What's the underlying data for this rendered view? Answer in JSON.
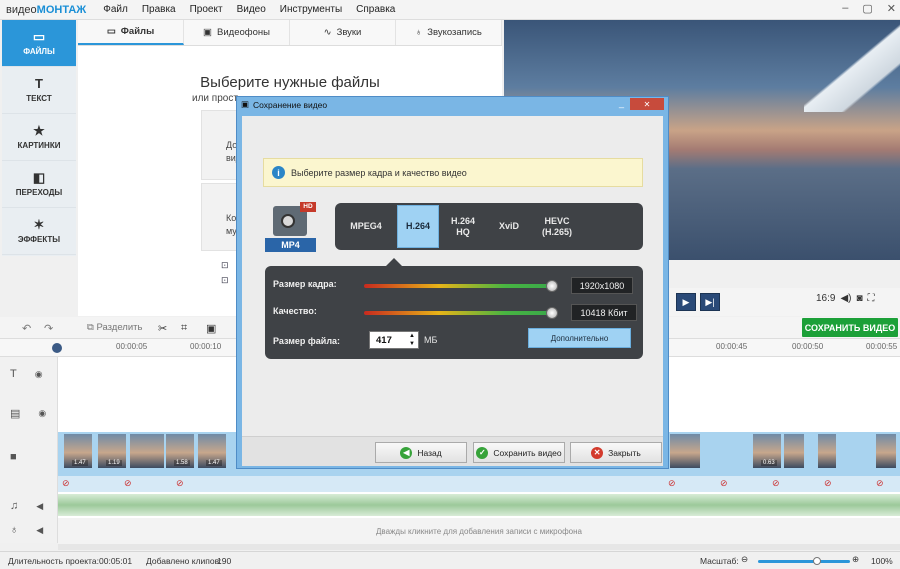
{
  "app": {
    "logo_plain": "видео",
    "logo_bold": "МОНТАЖ"
  },
  "menu": [
    "Файл",
    "Правка",
    "Проект",
    "Видео",
    "Инструменты",
    "Справка"
  ],
  "window_controls": [
    "–",
    "▢",
    "✕"
  ],
  "sidebar": [
    {
      "label": "ФАЙЛЫ",
      "icon": "folder-icon",
      "glyph": "▭"
    },
    {
      "label": "ТЕКСТ",
      "icon": "text-icon",
      "glyph": "T"
    },
    {
      "label": "КАРТИНКИ",
      "icon": "star-icon",
      "glyph": "★"
    },
    {
      "label": "ПЕРЕХОДЫ",
      "icon": "transition-icon",
      "glyph": "◧"
    },
    {
      "label": "ЭФФЕКТЫ",
      "icon": "wand-icon",
      "glyph": "✶"
    }
  ],
  "tabs": [
    {
      "label": "Файлы",
      "glyph": "▭"
    },
    {
      "label": "Видеофоны",
      "glyph": "▣"
    },
    {
      "label": "Звуки",
      "glyph": "∿"
    },
    {
      "label": "Звукозапись",
      "glyph": "♁"
    }
  ],
  "files": {
    "title": "Выберите нужные файлы",
    "subtitle": "или прост",
    "card1_a": "До",
    "card1_b": "виде",
    "card2_a": "Кол",
    "card2_b": "му"
  },
  "player": {
    "aspect": "16:9",
    "play": "▶",
    "next": "▶|"
  },
  "save_main": "СОХРАНИТЬ ВИДЕО",
  "edit_tools": {
    "split": "Разделить"
  },
  "ruler": [
    "00:00:05",
    "00:00:10",
    "00:00:45",
    "00:00:50",
    "00:00:55"
  ],
  "clip_numbers": [
    "1.47",
    "1.19",
    "1.58",
    "1.47",
    "0.63"
  ],
  "mic_hint": "Дважды кликните для добавления записи с микрофона",
  "status": {
    "duration_label": "Длительность проекта:",
    "duration": "00:05:01",
    "clips_label": "Добавлено клипов:",
    "clips": "190",
    "zoom_label": "Масштаб:",
    "zoom": "100%",
    "zoom_level": 0.6
  },
  "dialog": {
    "title": "Сохранение видео",
    "info": "Выберите размер кадра и качество видео",
    "format": "MP4",
    "format_badge": "HD",
    "codecs": [
      "MPEG4",
      "H.264",
      "H.264 HQ",
      "XviD",
      "HEVC (H.265)"
    ],
    "selected_codec": "H.264",
    "frame_label": "Размер кадра:",
    "frame_value": "1920x1080",
    "frame_level": 1.0,
    "quality_label": "Качество:",
    "quality_value": "10418 Кбит",
    "quality_level": 1.0,
    "filesize_label": "Размер файла:",
    "filesize_value": "417",
    "filesize_unit": "МБ",
    "advanced": "Дополнительно",
    "back": "Назад",
    "save": "Сохранить видео",
    "close": "Закрыть"
  }
}
